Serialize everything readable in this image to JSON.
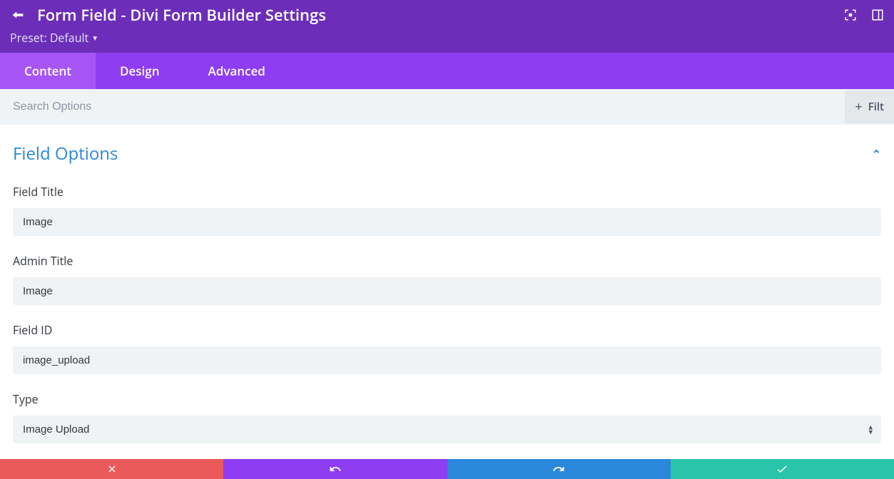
{
  "header": {
    "title": "Form Field - Divi Form Builder Settings",
    "preset_label": "Preset: Default"
  },
  "tabs": {
    "content": "Content",
    "design": "Design",
    "advanced": "Advanced"
  },
  "search": {
    "placeholder": "Search Options",
    "filter_label": "Filt"
  },
  "section": {
    "title": "Field Options"
  },
  "fields": {
    "field_title": {
      "label": "Field Title",
      "value": "Image"
    },
    "admin_title": {
      "label": "Admin Title",
      "value": "Image"
    },
    "field_id": {
      "label": "Field ID",
      "value": "image_upload"
    },
    "type": {
      "label": "Type",
      "value": "Image Upload"
    }
  }
}
